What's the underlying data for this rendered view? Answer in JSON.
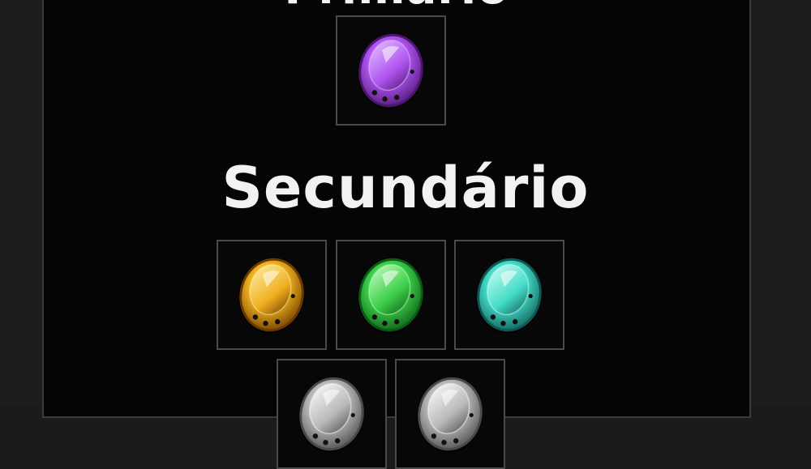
{
  "primary": {
    "title": "Primário",
    "gems": [
      {
        "name": "purple-gem",
        "color": "#b055f0",
        "dark": "#4a1670",
        "light": "#e6c4ff"
      }
    ]
  },
  "secondary": {
    "title": "Secundário",
    "gems": [
      {
        "name": "yellow-gem",
        "color": "#f0b020",
        "dark": "#6a3a00",
        "light": "#fff2a8"
      },
      {
        "name": "green-gem",
        "color": "#3ccf4a",
        "dark": "#0d5a16",
        "light": "#c8ffc4"
      },
      {
        "name": "cyan-gem",
        "color": "#45dcc8",
        "dark": "#0e5a52",
        "light": "#d2fff8"
      },
      {
        "name": "gray-gem",
        "color": "#b8b8b8",
        "dark": "#4a4a4a",
        "light": "#ffffff"
      },
      {
        "name": "gray-gem",
        "color": "#b8b8b8",
        "dark": "#4a4a4a",
        "light": "#ffffff"
      }
    ]
  }
}
